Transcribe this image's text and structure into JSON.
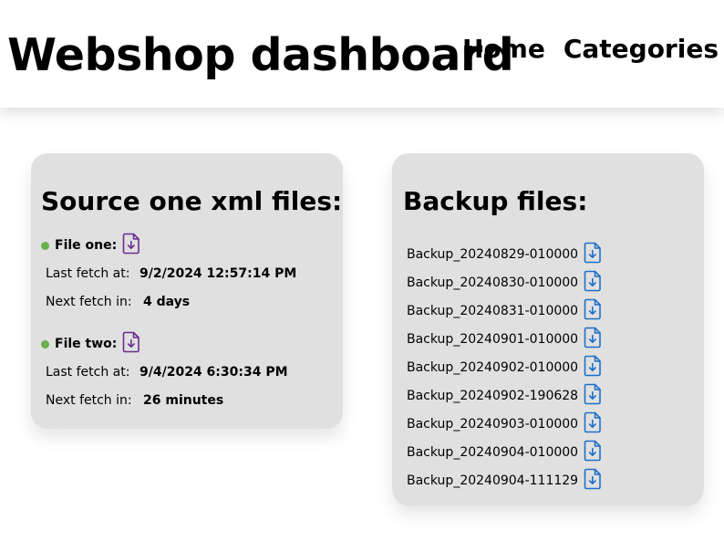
{
  "header": {
    "title": "Webshop dashboard",
    "nav": [
      {
        "label": "Home"
      },
      {
        "label": "Categories"
      }
    ]
  },
  "source": {
    "title": "Source one xml files:",
    "status_color": "#6ab04c",
    "icon_color": "#6a2c91",
    "files": [
      {
        "name": "File one:",
        "last_fetch_label": "Last fetch at:",
        "last_fetch_value": "9/2/2024 12:57:14 PM",
        "next_fetch_label": "Next fetch in:",
        "next_fetch_value": "4 days",
        "icon": "file-download-icon"
      },
      {
        "name": "File two:",
        "last_fetch_label": "Last fetch at:",
        "last_fetch_value": "9/4/2024 6:30:34 PM",
        "next_fetch_label": "Next fetch in:",
        "next_fetch_value": "26 minutes",
        "icon": "file-download-icon"
      }
    ]
  },
  "backup": {
    "title": "Backup files:",
    "icon_color": "#1e6fc9",
    "files": [
      {
        "name": "Backup_20240829-010000"
      },
      {
        "name": "Backup_20240830-010000"
      },
      {
        "name": "Backup_20240831-010000"
      },
      {
        "name": "Backup_20240901-010000"
      },
      {
        "name": "Backup_20240902-010000"
      },
      {
        "name": "Backup_20240902-190628"
      },
      {
        "name": "Backup_20240903-010000"
      },
      {
        "name": "Backup_20240904-010000"
      },
      {
        "name": "Backup_20240904-111129"
      }
    ]
  }
}
